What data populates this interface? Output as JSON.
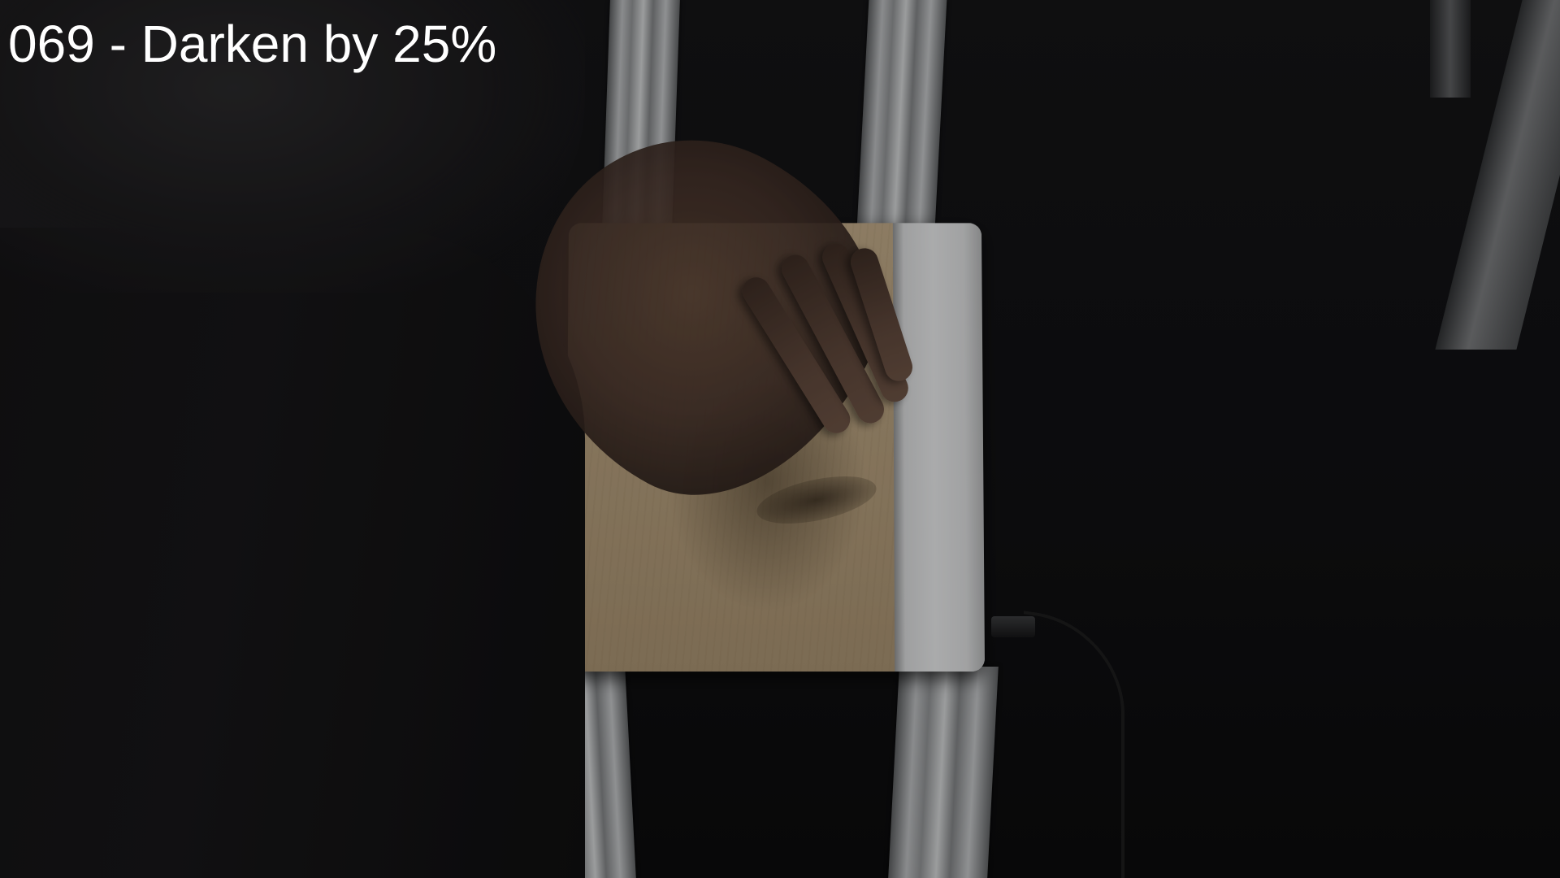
{
  "caption": {
    "text": "069 - Darken by 25%"
  },
  "scene": {
    "darken_fraction": 0.25,
    "objects": [
      "aluminum-rails",
      "wooden-tablet",
      "white-strip",
      "usb-cable",
      "hand",
      "dark-sleeve"
    ]
  },
  "colors": {
    "caption_text": "#ffffff",
    "background": "#0c0c0e",
    "wood": "#b29c7b",
    "strip": "#e3e4e5"
  }
}
